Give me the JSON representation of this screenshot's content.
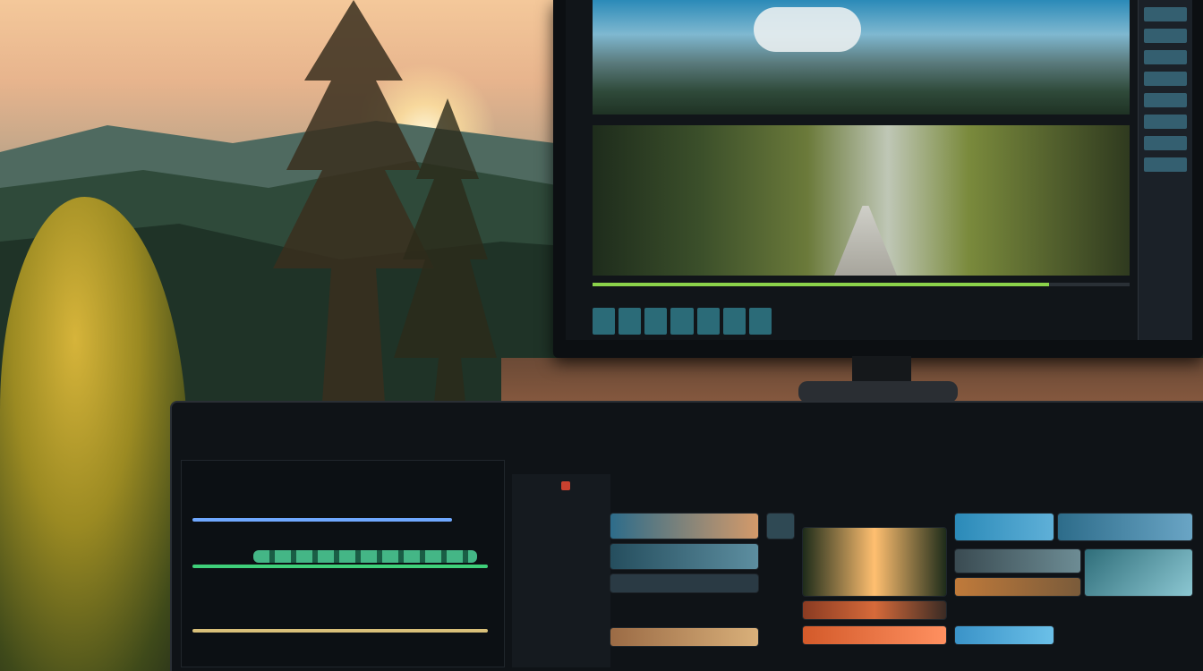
{
  "scene": {
    "description_icons": [
      "forest-background",
      "sunset",
      "monitor",
      "laptop-editor"
    ]
  },
  "colors": {
    "accent_green": "#8bd24a",
    "accent_teal": "#3b6f82",
    "accent_yellow": "#e5e266",
    "playhead_red": "#c9412f"
  },
  "monitor": {
    "timeline_progress": 0.85
  },
  "editor": {
    "menubar": [],
    "toolbar": [],
    "tracks": [],
    "clips": []
  }
}
